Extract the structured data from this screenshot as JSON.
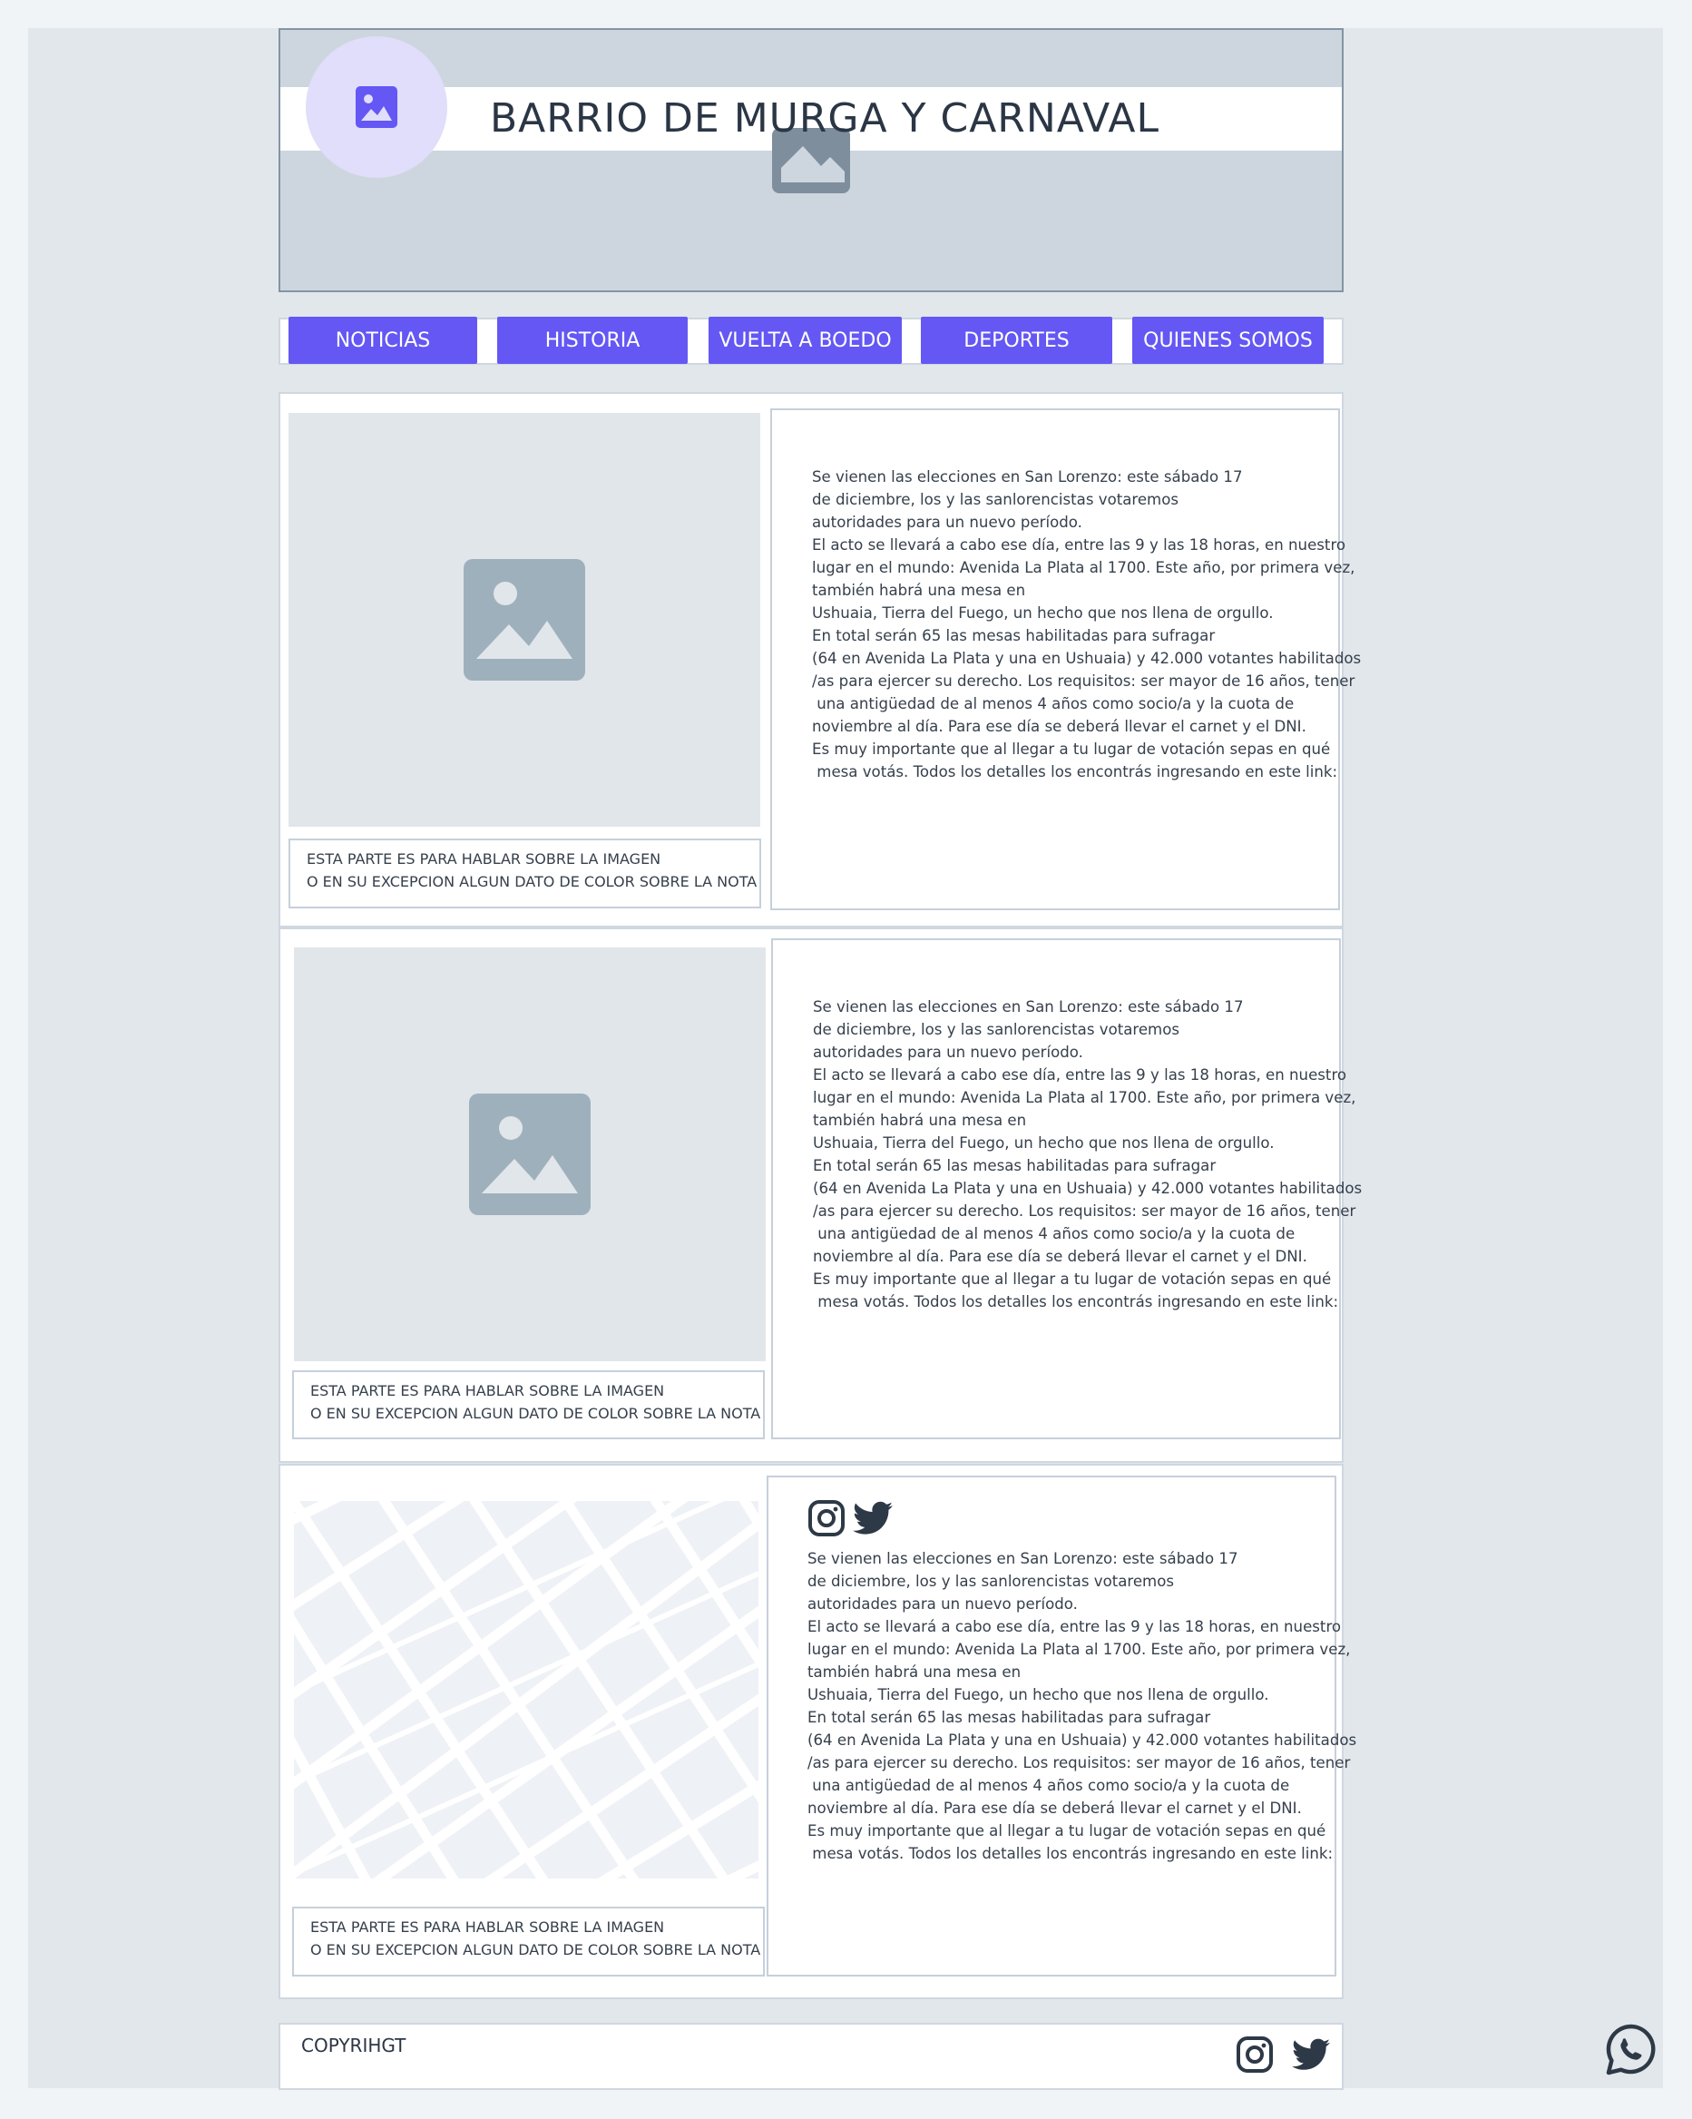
{
  "header": {
    "title": "BARRIO DE MURGA Y CARNAVAL",
    "logo_icon": "image-icon",
    "banner_icon": "image-icon"
  },
  "nav": {
    "items": [
      {
        "label": "NOTICIAS"
      },
      {
        "label": "HISTORIA"
      },
      {
        "label": "VUELTA A BOEDO"
      },
      {
        "label": "DEPORTES"
      },
      {
        "label": "QUIENES SOMOS"
      }
    ]
  },
  "articles": [
    {
      "image_icon": "image-icon",
      "caption": "ESTA PARTE ES PARA HABLAR SOBRE LA IMAGEN\nO EN SU EXCEPCION ALGUN DATO DE COLOR SOBRE LA NOTA",
      "body": "Se vienen las elecciones en San Lorenzo: este sábado 17\nde diciembre, los y las sanlorencistas votaremos\nautoridades para un nuevo período.\nEl acto se llevará a cabo ese día, entre las 9 y las 18 horas, en nuestro\nlugar en el mundo: Avenida La Plata al 1700. Este año, por primera vez,\ntambién habrá una mesa en\nUshuaia, Tierra del Fuego, un hecho que nos llena de orgullo.\nEn total serán 65 las mesas habilitadas para sufragar\n(64 en Avenida La Plata y una en Ushuaia) y 42.000 votantes habilitados\n/as para ejercer su derecho. Los requisitos: ser mayor de 16 años, tener\n una antigüedad de al menos 4 años como socio/a y la cuota de\nnoviembre al día. Para ese día se deberá llevar el carnet y el DNI.\nEs muy importante que al llegar a tu lugar de votación sepas en qué\n mesa votás. Todos los detalles los encontrás ingresando en este link:"
    },
    {
      "image_icon": "image-icon",
      "caption": "ESTA PARTE ES PARA HABLAR SOBRE LA IMAGEN\nO EN SU EXCEPCION ALGUN DATO DE COLOR SOBRE LA NOTA",
      "body": "Se vienen las elecciones en San Lorenzo: este sábado 17\nde diciembre, los y las sanlorencistas votaremos\nautoridades para un nuevo período.\nEl acto se llevará a cabo ese día, entre las 9 y las 18 horas, en nuestro\nlugar en el mundo: Avenida La Plata al 1700. Este año, por primera vez,\ntambién habrá una mesa en\nUshuaia, Tierra del Fuego, un hecho que nos llena de orgullo.\nEn total serán 65 las mesas habilitadas para sufragar\n(64 en Avenida La Plata y una en Ushuaia) y 42.000 votantes habilitados\n/as para ejercer su derecho. Los requisitos: ser mayor de 16 años, tener\n una antigüedad de al menos 4 años como socio/a y la cuota de\nnoviembre al día. Para ese día se deberá llevar el carnet y el DNI.\nEs muy importante que al llegar a tu lugar de votación sepas en qué\n mesa votás. Todos los detalles los encontrás ingresando en este link:"
    },
    {
      "image_icon": "map-placeholder",
      "caption": "ESTA PARTE ES PARA HABLAR SOBRE LA IMAGEN\nO EN SU EXCEPCION ALGUN DATO DE COLOR SOBRE LA NOTA",
      "social_icons": [
        "instagram-icon",
        "twitter-icon"
      ],
      "body": "Se vienen las elecciones en San Lorenzo: este sábado 17\nde diciembre, los y las sanlorencistas votaremos\nautoridades para un nuevo período.\nEl acto se llevará a cabo ese día, entre las 9 y las 18 horas, en nuestro\nlugar en el mundo: Avenida La Plata al 1700. Este año, por primera vez,\ntambién habrá una mesa en\nUshuaia, Tierra del Fuego, un hecho que nos llena de orgullo.\nEn total serán 65 las mesas habilitadas para sufragar\n(64 en Avenida La Plata y una en Ushuaia) y 42.000 votantes habilitados\n/as para ejercer su derecho. Los requisitos: ser mayor de 16 años, tener\n una antigüedad de al menos 4 años como socio/a y la cuota de\nnoviembre al día. Para ese día se deberá llevar el carnet y el DNI.\nEs muy importante que al llegar a tu lugar de votación sepas en qué\n mesa votás. Todos los detalles los encontrás ingresando en este link:"
    }
  ],
  "footer": {
    "copyright": "COPYRIHGT",
    "social_icons": [
      "instagram-icon",
      "twitter-icon"
    ]
  },
  "floating": {
    "icon": "whatsapp-icon"
  },
  "colors": {
    "accent": "#6457f4",
    "logo_bg": "#e0defb",
    "placeholder_icon": "#9fb0bd",
    "text": "#2e3947"
  }
}
